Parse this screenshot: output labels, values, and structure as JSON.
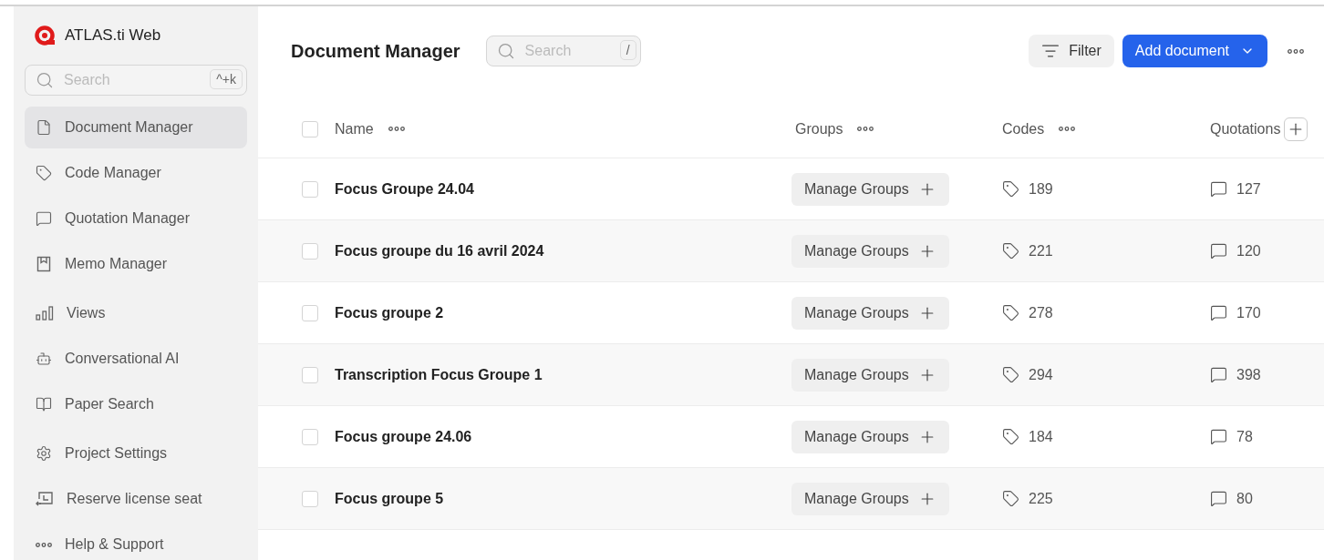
{
  "app": {
    "name": "ATLAS.ti Web"
  },
  "sidebar": {
    "search": {
      "placeholder": "Search",
      "shortcut": "^+k"
    },
    "items": [
      {
        "label": "Document Manager",
        "selected": true
      },
      {
        "label": "Code Manager",
        "selected": false
      },
      {
        "label": "Quotation Manager",
        "selected": false
      },
      {
        "label": "Memo Manager",
        "selected": false
      },
      {
        "label": "Views",
        "selected": false
      },
      {
        "label": "Conversational AI",
        "selected": false
      },
      {
        "label": "Paper Search",
        "selected": false
      },
      {
        "label": "Project Settings",
        "selected": false
      },
      {
        "label": "Reserve license seat",
        "selected": false
      },
      {
        "label": "Help & Support",
        "selected": false
      }
    ]
  },
  "header": {
    "title": "Document Manager",
    "search": {
      "placeholder": "Search",
      "shortcut": "/"
    },
    "filter": "Filter",
    "add": "Add document"
  },
  "table": {
    "select_all": false,
    "columns": [
      "Name",
      "Groups",
      "Codes",
      "Quotations"
    ],
    "rows": [
      {
        "name": "Focus Groupe 24.04",
        "groups": "Manage Groups",
        "codes": "189",
        "quotations": "127",
        "checked": false
      },
      {
        "name": "Focus groupe du 16 avril 2024",
        "groups": "Manage Groups",
        "codes": "221",
        "quotations": "120",
        "checked": false
      },
      {
        "name": "Focus groupe 2",
        "groups": "Manage Groups",
        "codes": "278",
        "quotations": "170",
        "checked": false
      },
      {
        "name": "Transcription Focus Groupe 1",
        "groups": "Manage Groups",
        "codes": "294",
        "quotations": "398",
        "checked": false
      },
      {
        "name": "Focus groupe 24.06",
        "groups": "Manage Groups",
        "codes": "184",
        "quotations": "78",
        "checked": false
      },
      {
        "name": "Focus groupe 5",
        "groups": "Manage Groups",
        "codes": "225",
        "quotations": "80",
        "checked": false
      }
    ]
  }
}
